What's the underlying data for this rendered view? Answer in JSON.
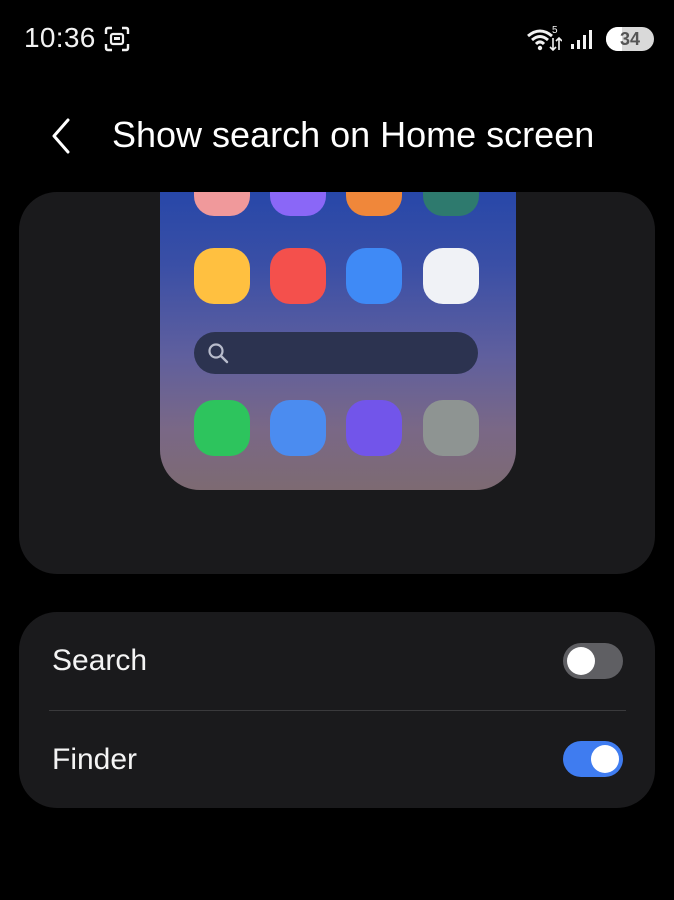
{
  "status_bar": {
    "time": "10:36",
    "battery_label": "34",
    "battery_level": 0.34,
    "wifi_badge": "5",
    "icons": [
      "screen-capture-icon",
      "wifi-icon",
      "signal-icon",
      "battery-icon"
    ]
  },
  "header": {
    "back_icon": "chevron-left-icon",
    "title": "Show search on Home screen"
  },
  "preview": {
    "app_icon_colors": {
      "row0": [
        "#f0999b",
        "#8a67f7",
        "#f0873a",
        "#2e7a6e"
      ],
      "row1": [
        "#ffc040",
        "#f4504c",
        "#3f8af6",
        "#f0f2f6"
      ],
      "row3": [
        "#2dc45d",
        "#4b8cf0",
        "#7255ea",
        "#8e9492"
      ]
    },
    "search_bar_icon": "search-icon"
  },
  "options": [
    {
      "label": "Search",
      "enabled": false
    },
    {
      "label": "Finder",
      "enabled": true
    }
  ],
  "colors": {
    "background": "#000000",
    "card": "#1a1a1c",
    "toggle_on": "#3f7cf0",
    "toggle_off": "#5f5f63",
    "divider": "#3a3a3c"
  }
}
